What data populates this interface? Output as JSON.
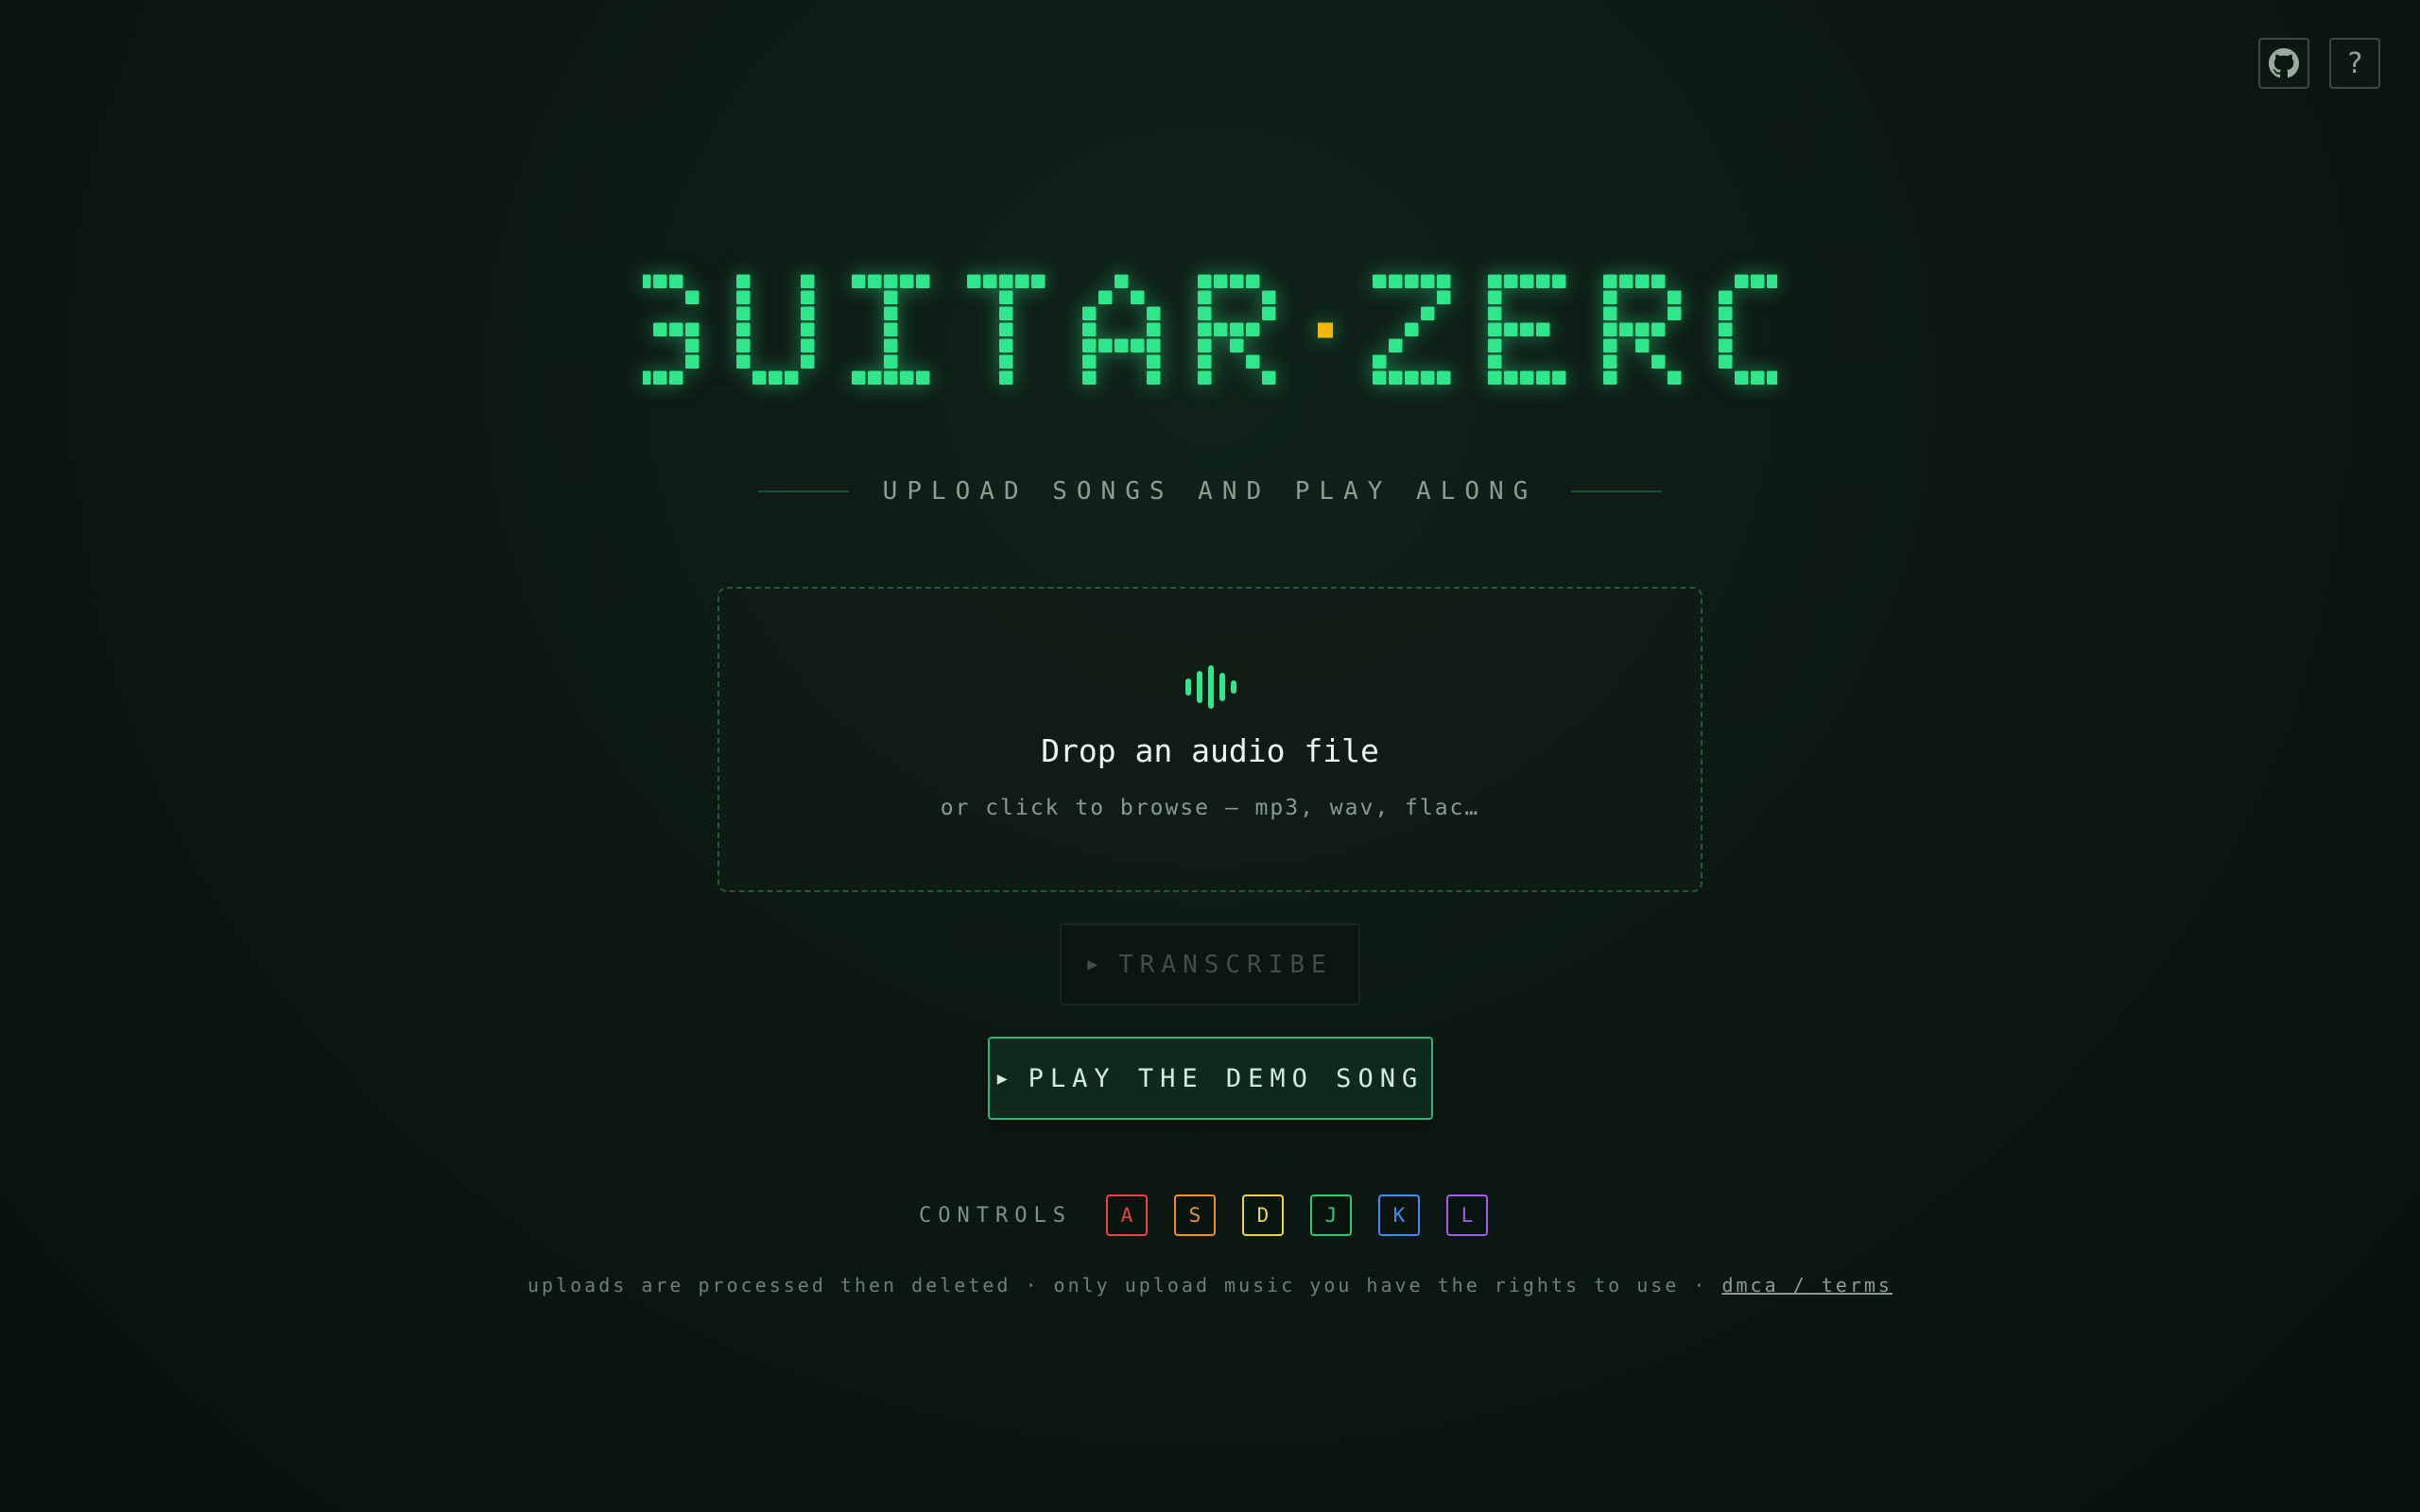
{
  "header": {
    "github_icon": "github-icon",
    "help_label": "?"
  },
  "logo": {
    "text": "GUITAR ZERO",
    "word1": "GUITAR",
    "word2": "ZERO",
    "color": "#2fe68a",
    "dot_color": "#f2b705"
  },
  "subtitle": "UPLOAD SONGS AND PLAY ALONG",
  "dropzone": {
    "icon": "audio-wave-icon",
    "title": "Drop an audio file",
    "subtitle": "or click to browse — mp3, wav, flac…"
  },
  "transcribe": {
    "label": "TRANSCRIBE",
    "icon": "play-icon",
    "disabled": true
  },
  "demo": {
    "label": "PLAY THE DEMO SONG",
    "icon": "play-icon"
  },
  "controls": {
    "label": "CONTROLS",
    "keys": [
      {
        "key": "A",
        "color": "#e84545"
      },
      {
        "key": "S",
        "color": "#f0902a"
      },
      {
        "key": "D",
        "color": "#f0d24a"
      },
      {
        "key": "J",
        "color": "#2fc872"
      },
      {
        "key": "K",
        "color": "#3d8ef0"
      },
      {
        "key": "L",
        "color": "#a65be8"
      }
    ]
  },
  "footer": {
    "text": "uploads are processed then deleted · only upload music you have the rights to use · ",
    "link": "dmca / terms"
  }
}
